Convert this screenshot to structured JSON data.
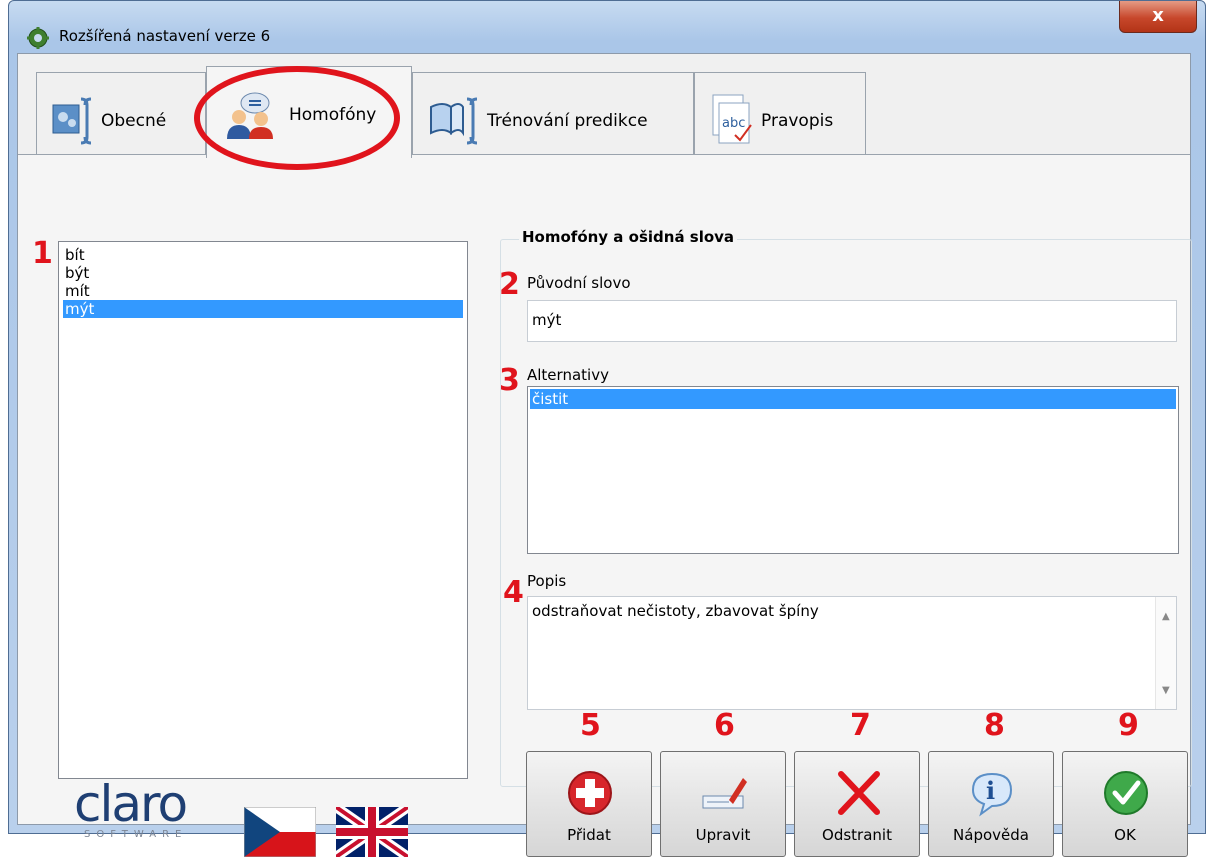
{
  "window": {
    "title": "Rozšířená nastavení verze 6",
    "close_label": "x"
  },
  "tabs": [
    {
      "label": "Obecné",
      "icon": "settings-icon"
    },
    {
      "label": "Homofóny",
      "icon": "people-speech-icon",
      "active": true
    },
    {
      "label": "Trénování predikce",
      "icon": "book-icon"
    },
    {
      "label": "Pravopis",
      "icon": "spellcheck-icon"
    }
  ],
  "annotations": [
    "1",
    "2",
    "3",
    "4",
    "5",
    "6",
    "7",
    "8",
    "9"
  ],
  "word_list": {
    "items": [
      "bít",
      "být",
      "mít",
      "mýt"
    ],
    "selected": "mýt"
  },
  "group": {
    "title": "Homofóny a ošidná slova",
    "original_label": "Původní slovo",
    "original_value": "mýt",
    "alternatives_label": "Alternativy",
    "alternatives": [
      "čistit"
    ],
    "description_label": "Popis",
    "description_value": "odstraňovat nečistoty, zbavovat špíny"
  },
  "buttons": {
    "add": "Přidat",
    "edit": "Upravit",
    "remove": "Odstranit",
    "help": "Nápověda",
    "ok": "OK"
  },
  "logo": {
    "name": "claro",
    "sub": "SOFTWARE"
  },
  "colors": {
    "selection": "#3399ff",
    "annotation_red": "#e0141c"
  }
}
